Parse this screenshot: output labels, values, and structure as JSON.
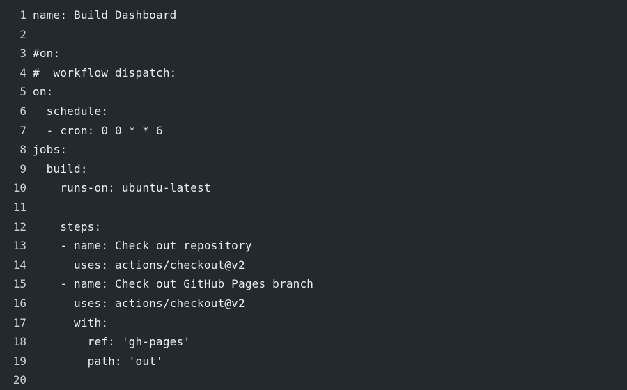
{
  "editor": {
    "lines": [
      {
        "n": "1",
        "t": "name: Build Dashboard"
      },
      {
        "n": "2",
        "t": ""
      },
      {
        "n": "3",
        "t": "#on:"
      },
      {
        "n": "4",
        "t": "#  workflow_dispatch:"
      },
      {
        "n": "5",
        "t": "on:"
      },
      {
        "n": "6",
        "t": "  schedule:"
      },
      {
        "n": "7",
        "t": "  - cron: 0 0 * * 6"
      },
      {
        "n": "8",
        "t": "jobs:"
      },
      {
        "n": "9",
        "t": "  build:"
      },
      {
        "n": "10",
        "t": "    runs-on: ubuntu-latest"
      },
      {
        "n": "11",
        "t": ""
      },
      {
        "n": "12",
        "t": "    steps:"
      },
      {
        "n": "13",
        "t": "    - name: Check out repository"
      },
      {
        "n": "14",
        "t": "      uses: actions/checkout@v2"
      },
      {
        "n": "15",
        "t": "    - name: Check out GitHub Pages branch"
      },
      {
        "n": "16",
        "t": "      uses: actions/checkout@v2"
      },
      {
        "n": "17",
        "t": "      with:"
      },
      {
        "n": "18",
        "t": "        ref: 'gh-pages'"
      },
      {
        "n": "19",
        "t": "        path: 'out'"
      },
      {
        "n": "20",
        "t": ""
      }
    ]
  },
  "colors": {
    "background": "#24292e",
    "text": "#e6edf3",
    "line_number": "#c9d1d9"
  }
}
